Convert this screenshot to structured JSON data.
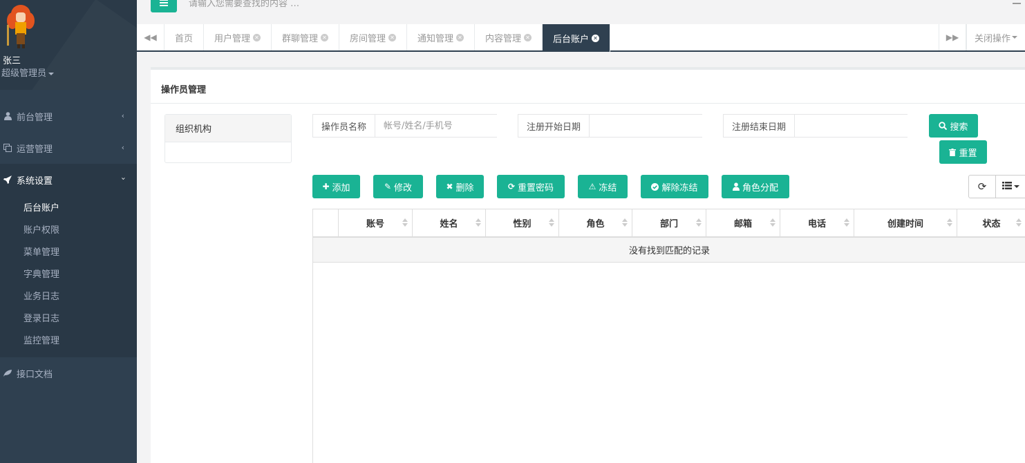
{
  "profile": {
    "name": "张三",
    "role": "超级管理员"
  },
  "topbar": {
    "search_placeholder": "请输入您需要查找的内容 …"
  },
  "sidebar": {
    "items": [
      {
        "label": "前台管理",
        "icon": "user-icon"
      },
      {
        "label": "运营管理",
        "icon": "copy-icon"
      },
      {
        "label": "系统设置",
        "icon": "rocket-icon"
      },
      {
        "label": "接口文档",
        "icon": "leaf-icon"
      }
    ],
    "sub_items": [
      "后台账户",
      "账户权限",
      "菜单管理",
      "字典管理",
      "业务日志",
      "登录日志",
      "监控管理"
    ]
  },
  "tabs": [
    "首页",
    "用户管理",
    "群聊管理",
    "房间管理",
    "通知管理",
    "内容管理",
    "后台账户"
  ],
  "tabs_close_label": "关闭操作",
  "panel": {
    "title": "操作员管理",
    "org_title": "组织机构"
  },
  "filters": {
    "operator_label": "操作员名称",
    "operator_placeholder": "帐号/姓名/手机号",
    "start_label": "注册开始日期",
    "end_label": "注册结束日期",
    "search_btn": "搜索",
    "reset_btn": "重置"
  },
  "toolbar": {
    "add": "添加",
    "edit": "修改",
    "delete": "删除",
    "reset_pwd": "重置密码",
    "freeze": "冻结",
    "unfreeze": "解除冻结",
    "role_assign": "角色分配"
  },
  "table": {
    "columns": [
      "账号",
      "姓名",
      "性别",
      "角色",
      "部门",
      "邮箱",
      "电话",
      "创建时间",
      "状态"
    ],
    "empty_text": "没有找到匹配的记录"
  },
  "colors": {
    "accent": "#1ab394",
    "sidebar": "#2f4050"
  }
}
